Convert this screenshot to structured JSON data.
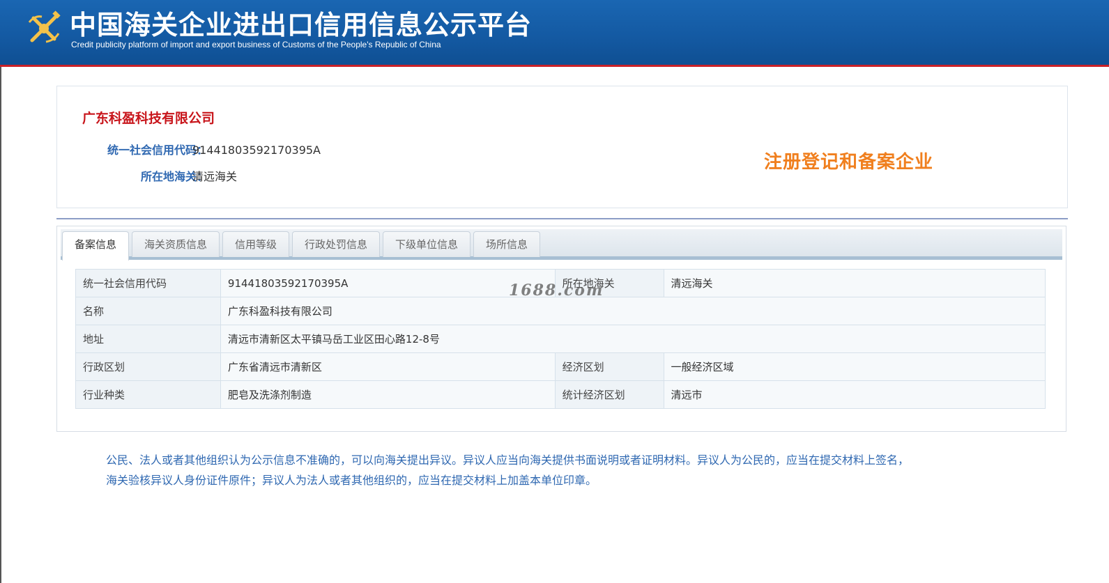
{
  "header": {
    "title": "中国海关企业进出口信用信息公示平台",
    "subtitle": "Credit publicity platform of import and export business of Customs of the People's Republic of China",
    "emblem_icon": "customs-emblem-icon",
    "background_color": "#145aa3",
    "accent_color": "#c92027"
  },
  "company": {
    "name": "广东科盈科技有限公司",
    "credit_code_label": "统一社会信用代码：",
    "credit_code": "91441803592170395A",
    "customs_label": "所在地海关：",
    "customs": "清远海关",
    "registration_status": "注册登记和备案企业"
  },
  "tabs": [
    {
      "label": "备案信息",
      "active": true
    },
    {
      "label": "海关资质信息",
      "active": false
    },
    {
      "label": "信用等级",
      "active": false
    },
    {
      "label": "行政处罚信息",
      "active": false
    },
    {
      "label": "下级单位信息",
      "active": false
    },
    {
      "label": "场所信息",
      "active": false
    }
  ],
  "table": {
    "row1": {
      "label1": "统一社会信用代码",
      "value1": "91441803592170395A",
      "label2": "所在地海关",
      "value2": "清远海关"
    },
    "row2": {
      "label": "名称",
      "value": "广东科盈科技有限公司"
    },
    "row3": {
      "label": "地址",
      "value": "清远市清新区太平镇马岳工业区田心路12-8号"
    },
    "row4": {
      "label1": "行政区划",
      "value1": "广东省清远市清新区",
      "label2": "经济区划",
      "value2": "一般经济区域"
    },
    "row5": {
      "label1": "行业种类",
      "value1": "肥皂及洗涤剂制造",
      "label2": "统计经济区划",
      "value2": "清远市"
    }
  },
  "watermark": "1688.com",
  "notice": {
    "line1": "公民、法人或者其他组织认为公示信息不准确的，可以向海关提出异议。异议人应当向海关提供书面说明或者证明材料。异议人为公民的，应当在提交材料上签名，",
    "line2": "海关验核异议人身份证件原件；异议人为法人或者其他组织的，应当在提交材料上加盖本单位印章。"
  }
}
